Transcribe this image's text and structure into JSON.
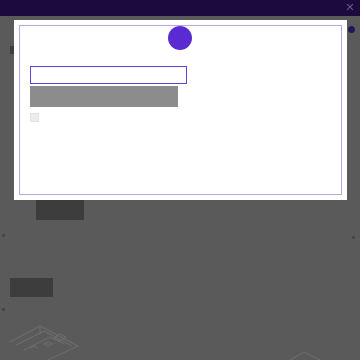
{
  "window": {
    "close_glyph": "✕",
    "colors": {
      "titlebar": "#1c0a3c",
      "backdrop": "#5a5a5a",
      "accent": "#5a2ad2"
    }
  },
  "modal": {
    "avatar_icon": "avatar-circle-icon",
    "input": {
      "value": "",
      "placeholder": ""
    },
    "submit_label": "",
    "checkbox_checked": false
  }
}
